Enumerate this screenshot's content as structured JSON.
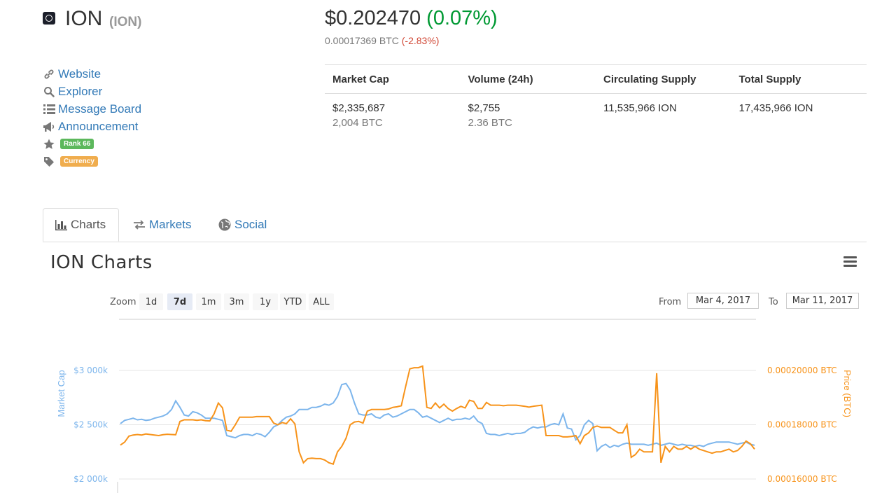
{
  "coin": {
    "name": "ION",
    "symbol": "(ION)",
    "price_usd": "$0.202470",
    "price_change": "(0.07%)",
    "price_btc": "0.00017369 BTC",
    "price_btc_change": "(-2.83%)"
  },
  "links": {
    "website": "Website",
    "explorer": "Explorer",
    "message_board": "Message Board",
    "announcement": "Announcement",
    "rank": "Rank 66",
    "category": "Currency"
  },
  "stats": {
    "headers": [
      "Market Cap",
      "Volume (24h)",
      "Circulating Supply",
      "Total Supply"
    ],
    "market_cap_usd": "$2,335,687",
    "market_cap_btc": "2,004 BTC",
    "volume_usd": "$2,755",
    "volume_btc": "2.36 BTC",
    "circulating_supply": "11,535,966 ION",
    "total_supply": "17,435,966 ION"
  },
  "tabs": [
    "Charts",
    "Markets",
    "Social"
  ],
  "chart": {
    "title": "ION Charts",
    "zoom_label": "Zoom",
    "zoom_options": [
      "1d",
      "7d",
      "1m",
      "3m",
      "1y",
      "YTD",
      "ALL"
    ],
    "zoom_selected": "7d",
    "from_label": "From",
    "from_value": "Mar 4, 2017",
    "to_label": "To",
    "to_value": "Mar 11, 2017"
  },
  "chart_data": {
    "type": "line",
    "yaxis_left": {
      "label": "Market Cap",
      "ticks": [
        "$3 000k",
        "$2 500k",
        "$2 000k"
      ],
      "range": [
        2000,
        3000
      ]
    },
    "yaxis_right": {
      "label": "Price (BTC)",
      "ticks": [
        "0.00020000 BTC",
        "0.00018000 BTC",
        "0.00016000 BTC"
      ],
      "range": [
        0.00016,
        0.0002
      ]
    },
    "grid": true,
    "colors": {
      "market_cap": "#7cb5ec",
      "price_btc": "#f7931a"
    },
    "series": [
      {
        "values": [
          2510,
          2540,
          2550,
          2560,
          2545,
          2550,
          2540,
          2545,
          2560,
          2570,
          2580,
          2600,
          2640,
          2720,
          2660,
          2590,
          2580,
          2620,
          2610,
          2590,
          2560,
          2560,
          2560,
          2550,
          2540,
          2400,
          2390,
          2380,
          2400,
          2410,
          2410,
          2400,
          2420,
          2410,
          2390,
          2430,
          2480,
          2500,
          2540,
          2570,
          2580,
          2600,
          2640,
          2640,
          2640,
          2660,
          2660,
          2670,
          2690,
          2680,
          2700,
          2760,
          2870,
          2880,
          2820,
          2700,
          2600,
          2590,
          2590,
          2600,
          2570,
          2560,
          2590,
          2600,
          2570,
          2580,
          2600,
          2620,
          2640,
          2640,
          2610,
          2570,
          2580,
          2560,
          2540,
          2520,
          2540,
          2560,
          2540,
          2550,
          2550,
          2560,
          2550,
          2580,
          2530,
          2510,
          2420,
          2410,
          2410,
          2400,
          2410,
          2420,
          2410,
          2420,
          2420,
          2430,
          2460,
          2480,
          2470,
          2480,
          2480,
          2500,
          2510,
          2500,
          2600,
          2470,
          2460,
          2360,
          2400,
          2500,
          2540,
          2510,
          2260,
          2300,
          2320,
          2290,
          2310,
          2300,
          2320,
          2330,
          2320,
          2320,
          2320,
          2320,
          2310,
          2320,
          2330,
          2310,
          2320,
          2330,
          2320,
          2310,
          2320,
          2310,
          2310,
          2300,
          2310,
          2300,
          2320,
          2330,
          2340,
          2340,
          2340,
          2340,
          2330,
          2320,
          2330,
          2340,
          2320,
          2310
        ]
      },
      {
        "values": [
          0.0001725,
          0.0001736,
          0.0001758,
          0.0001762,
          0.0001764,
          0.0001762,
          0.0001766,
          0.0001764,
          0.0001762,
          0.000176,
          0.0001763,
          0.0001765,
          0.0001764,
          0.0001763,
          0.0001812,
          0.0001818,
          0.0001818,
          0.0001818,
          0.0001816,
          0.0001818,
          0.0001815,
          0.0001814,
          0.000184,
          0.000188,
          0.0001862,
          0.000178,
          0.0001776,
          0.00018,
          0.0001828,
          0.0001828,
          0.0001828,
          0.0001828,
          0.000183,
          0.000183,
          0.000183,
          0.000183,
          0.0001806,
          0.00018,
          0.0001808,
          0.0001804,
          0.0001822,
          0.0001803,
          0.00017,
          0.000166,
          0.0001675,
          0.0001677,
          0.0001675,
          0.0001675,
          0.000167,
          0.000166,
          0.0001655,
          0.00017,
          0.000172,
          0.000175,
          0.00018,
          0.000181,
          0.0001812,
          0.0001806,
          0.000185,
          0.0001856,
          0.0001856,
          0.0001856,
          0.0001856,
          0.0001858,
          0.0001864,
          0.0001866,
          0.000187,
          0.000194,
          0.0002006,
          0.000201,
          0.000201,
          0.0002016,
          0.0001864,
          0.000186,
          0.000188,
          0.0001862,
          0.0001876,
          0.000186,
          0.000185,
          0.000186,
          0.0001868,
          0.0001862,
          0.000189,
          0.0001886,
          0.000186,
          0.000186,
          0.0001882,
          0.0001872,
          0.0001872,
          0.0001872,
          0.000187,
          0.0001872,
          0.0001872,
          0.0001872,
          0.000187,
          0.0001868,
          0.0001865,
          0.0001868,
          0.000187,
          0.0001872,
          0.000176,
          0.000176,
          0.000176,
          0.000176,
          0.0001755,
          0.0001755,
          0.0001757,
          0.000176,
          0.000173,
          0.000176,
          0.000177,
          0.000179,
          0.0001795,
          0.000179,
          0.000179,
          0.000179,
          0.000178,
          0.000177,
          0.000177,
          0.00018,
          0.000168,
          0.000169,
          0.000171,
          0.00017,
          0.00017,
          0.00017,
          0.000199,
          0.000166,
          0.000172,
          0.00017,
          0.000172,
          0.000171,
          0.000171,
          0.000172,
          0.000171,
          0.000172,
          0.000171,
          0.0001705,
          0.00017,
          0.0001695,
          0.00017,
          0.00017,
          0.0001705,
          0.000171,
          0.00017,
          0.0001705,
          0.000172,
          0.000174,
          0.000173,
          0.000171
        ]
      }
    ]
  }
}
